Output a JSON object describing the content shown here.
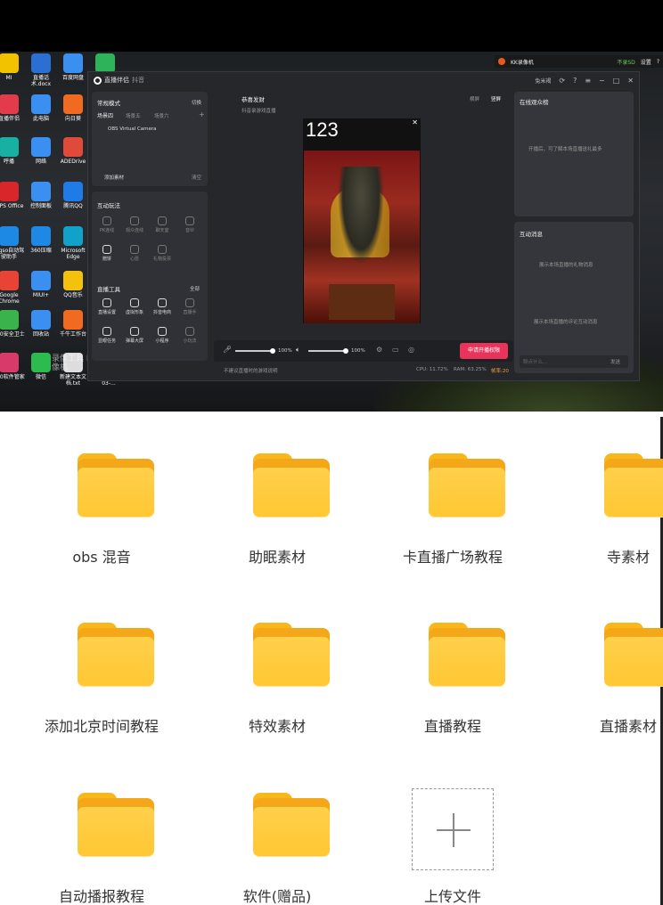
{
  "desktop": {
    "icons": [
      {
        "label": "MI",
        "color": "#f2c200"
      },
      {
        "label": "直播话术.docx",
        "color": "#2b6fd3"
      },
      {
        "label": "百度网盘",
        "color": "#3a8ff0"
      },
      {
        "label": "",
        "color": "#2fb35a"
      },
      {
        "label": "直播伴侣",
        "color": "#e23b4b"
      },
      {
        "label": "此电脑",
        "color": "#3a8ff0"
      },
      {
        "label": "向日葵",
        "color": "#f06a22"
      },
      {
        "label": "呼播",
        "color": "#19b0a4"
      },
      {
        "label": "网络",
        "color": "#3a8ff0"
      },
      {
        "label": "ADEDrive",
        "color": "#e04a3a"
      },
      {
        "label": "WPS Office",
        "color": "#d8262a"
      },
      {
        "label": "控制面板",
        "color": "#3a8ff0"
      },
      {
        "label": "腾讯QQ",
        "color": "#1e7be8"
      },
      {
        "label": "Bigso自动驾驶助手",
        "color": "#1e88e5"
      },
      {
        "label": "360压缩",
        "color": "#1e88e5"
      },
      {
        "label": "Microsoft Edge",
        "color": "#12a1c9"
      },
      {
        "label": "Google Chrome",
        "color": "#e84335"
      },
      {
        "label": "MIUI+",
        "color": "#3a8ff0"
      },
      {
        "label": "QQ音乐",
        "color": "#f4c20d"
      },
      {
        "label": "360安全卫士",
        "color": "#3ab44a"
      },
      {
        "label": "回收站",
        "color": "#3a8ff0"
      },
      {
        "label": "千牛工作台",
        "color": "#f06a22"
      },
      {
        "label": "360软件管家",
        "color": "#d83b6a"
      },
      {
        "label": "微信",
        "color": "#2bbb4f"
      },
      {
        "label": "新建文本文档.txt",
        "color": "#dddddd"
      },
      {
        "label": "kk 2023-03-...",
        "color": "#444444"
      }
    ],
    "watermark": "录像工具 KK录像机",
    "tray": {
      "app_name": "KK录像机",
      "rec_status": "不录SD",
      "settings": "设置",
      "help": "?"
    }
  },
  "app": {
    "title": "直播伴侣",
    "subtitle": "抖音",
    "user": "兔米褐",
    "mode_label": "常规模式",
    "switch_label": "切换",
    "scenes": [
      "场景四",
      "场景五",
      "场景六"
    ],
    "source_item": "OBS Virtual Camera",
    "add_source": "添加素材",
    "clear": "清空",
    "interact_title": "互动玩法",
    "interact_tools": [
      "PK连线",
      "观众连线",
      "聊天室",
      "音伙",
      "赠饼",
      "心愿",
      "礼物投票"
    ],
    "live_tools_title": "直播工具",
    "live_tools_all": "全部",
    "live_tools": [
      "直播设置",
      "虚拟形象",
      "抖音电商",
      "直播手",
      "显眼任务",
      "弹幕大屏",
      "小程序",
      "小玩法"
    ],
    "hint": "不建议直播时的游戏说明",
    "stream_title": "恭喜发财",
    "stream_sub": "抖音录游戏直播",
    "tabs": [
      "横屏",
      "竖屏"
    ],
    "preview_text": "123",
    "volume_left": "100%",
    "volume_right": "100%",
    "go_live": "申请开播权限",
    "cpu": "CPU: 11.72%",
    "ram": "RAM: 63.25%",
    "fps": "帧率:20",
    "audience_title": "在线观众榜",
    "audience_empty": "开播后，可了解本场直播送礼最多",
    "messages_title": "互动消息",
    "messages_gift": "展示本场直播的礼物消息",
    "messages_comment": "展示本场直播的评论互动消息",
    "msg_input_placeholder": "聊点什么...",
    "send": "发送"
  },
  "folders": [
    {
      "label": "obs 混音"
    },
    {
      "label": "助眠素材"
    },
    {
      "label": "卡直播广场教程"
    },
    {
      "label": "寺素材"
    },
    {
      "label": "添加北京时间教程"
    },
    {
      "label": "特效素材"
    },
    {
      "label": "直播教程"
    },
    {
      "label": "直播素材"
    },
    {
      "label": "自动播报教程"
    },
    {
      "label": "软件(赠品)"
    }
  ],
  "upload": {
    "label": "上传文件"
  },
  "colors": {
    "folder": "#ffc733",
    "folder_back": "#f4a719",
    "go_live": "#e8345a"
  }
}
